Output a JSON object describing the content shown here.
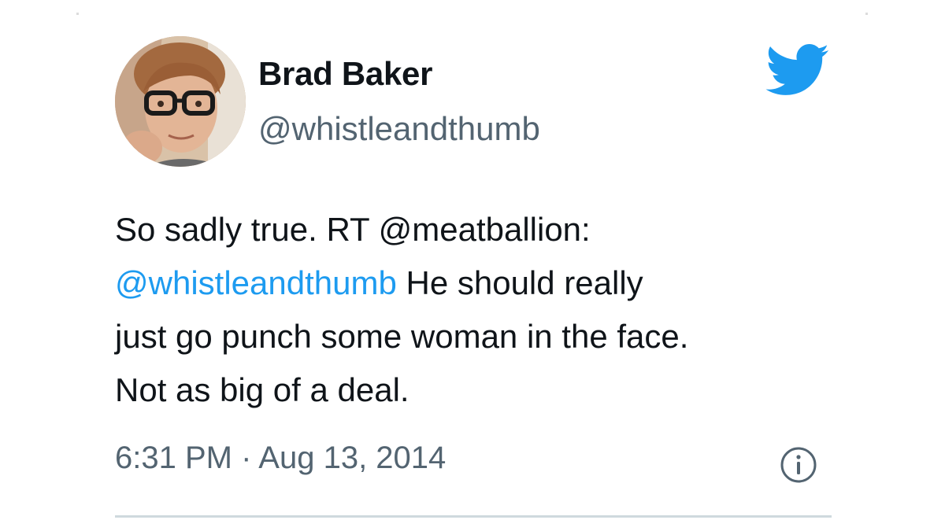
{
  "tweet": {
    "author": {
      "display_name": "Brad Baker",
      "handle": "@whistleandthumb",
      "avatar_icon": "profile-photo"
    },
    "text": {
      "line1": "So sadly true. RT @meatballion:",
      "line2_mention": "@whistleandthumb",
      "line2_rest": " He should really",
      "line3": "just go punch some woman in the face.",
      "line4": "Not as big of a deal."
    },
    "timestamp": "6:31 PM · Aug 13, 2014",
    "brand_icon": "twitter-bird-icon",
    "info_icon": "info-icon"
  },
  "colors": {
    "brand": "#1d9bf0",
    "text": "#0f1419",
    "secondary": "#536471",
    "divider": "#cfd9de"
  }
}
